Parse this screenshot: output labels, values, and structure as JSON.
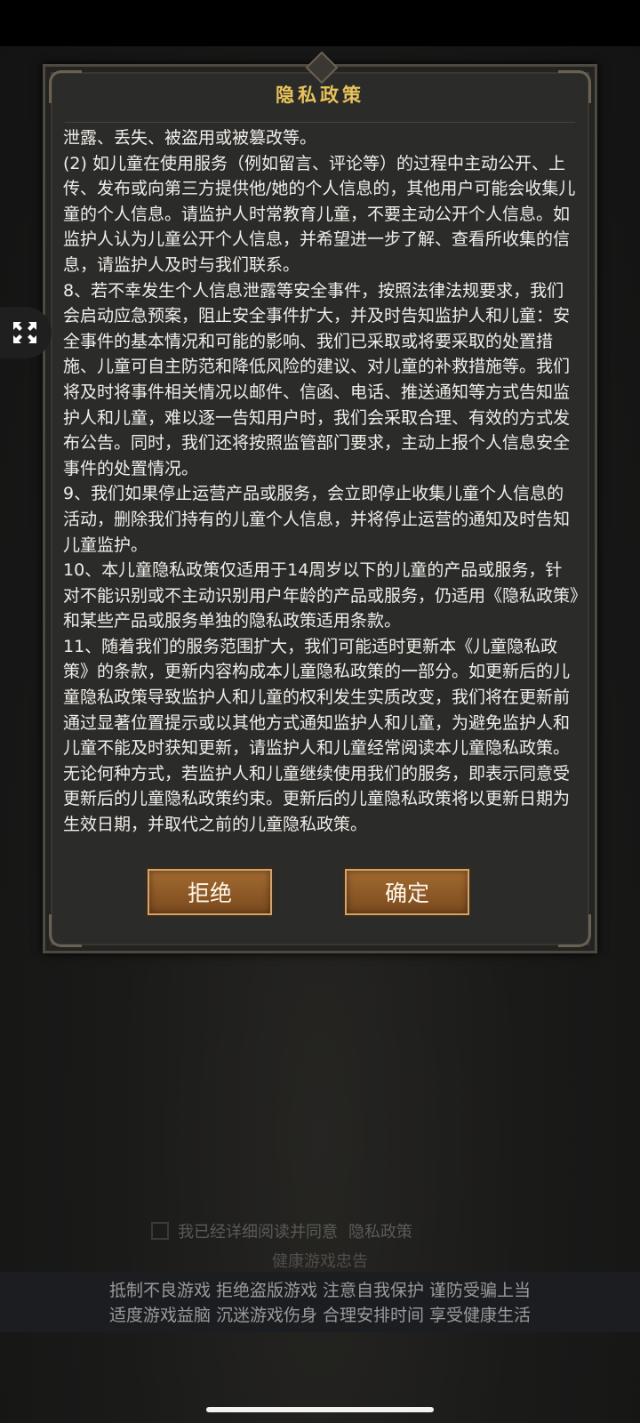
{
  "dialog": {
    "title": "隐私政策",
    "paragraphs": [
      "泄露、丢失、被盗用或被篡改等。",
      " (2) 如儿童在使用服务（例如留言、评论等）的过程中主动公开、上传、发布或向第三方提供他/她的个人信息的，其他用户可能会收集儿童的个人信息。请监护人时常教育儿童，不要主动公开个人信息。如监护人认为儿童公开个人信息，并希望进一步了解、查看所收集的信息，请监护人及时与我们联系。",
      " 8、若不幸发生个人信息泄露等安全事件，按照法律法规要求，我们会启动应急预案，阻止安全事件扩大，并及时告知监护人和儿童：安全事件的基本情况和可能的影响、我们已采取或将要采取的处置措施、儿童可自主防范和降低风险的建议、对儿童的补救措施等。我们将及时将事件相关情况以邮件、信函、电话、推送通知等方式告知监护人和儿童，难以逐一告知用户时，我们会采取合理、有效的方式发布公告。同时，我们还将按照监管部门要求，主动上报个人信息安全事件的处置情况。",
      " 9、我们如果停止运营产品或服务，会立即停止收集儿童个人信息的活动，删除我们持有的儿童个人信息，并将停止运营的通知及时告知儿童监护。",
      " 10、本儿童隐私政策仅适用于14周岁以下的儿童的产品或服务，针对不能识别或不主动识别用户年龄的产品或服务，仍适用《隐私政策》和某些产品或服务单独的隐私政策适用条款。",
      " 11、随着我们的服务范围扩大，我们可能适时更新本《儿童隐私政策》的条款，更新内容构成本儿童隐私政策的一部分。如更新后的儿童隐私政策导致监护人和儿童的权利发生实质改变，我们将在更新前通过显著位置提示或以其他方式通知监护人和儿童，为避免监护人和儿童不能及时获知更新，请监护人和儿童经常阅读本儿童隐私政策。无论何种方式，若监护人和儿童继续使用我们的服务，即表示同意受更新后的儿童隐私政策约束。更新后的儿童隐私政策将以更新日期为生效日期，并取代之前的儿童隐私政策。"
    ],
    "reject_label": "拒绝",
    "confirm_label": "确定"
  },
  "floating_button": {
    "icon": "expand-arrows-icon"
  },
  "agreement": {
    "text": "我已经详细阅读并同意",
    "link": "隐私政策",
    "checked": false
  },
  "health_notice": {
    "title": "健康游戏忠告",
    "line1": "抵制不良游戏 拒绝盗版游戏 注意自我保护 谨防受骗上当",
    "line2": "适度游戏益脑 沉迷游戏伤身 合理安排时间 享受健康生活"
  }
}
